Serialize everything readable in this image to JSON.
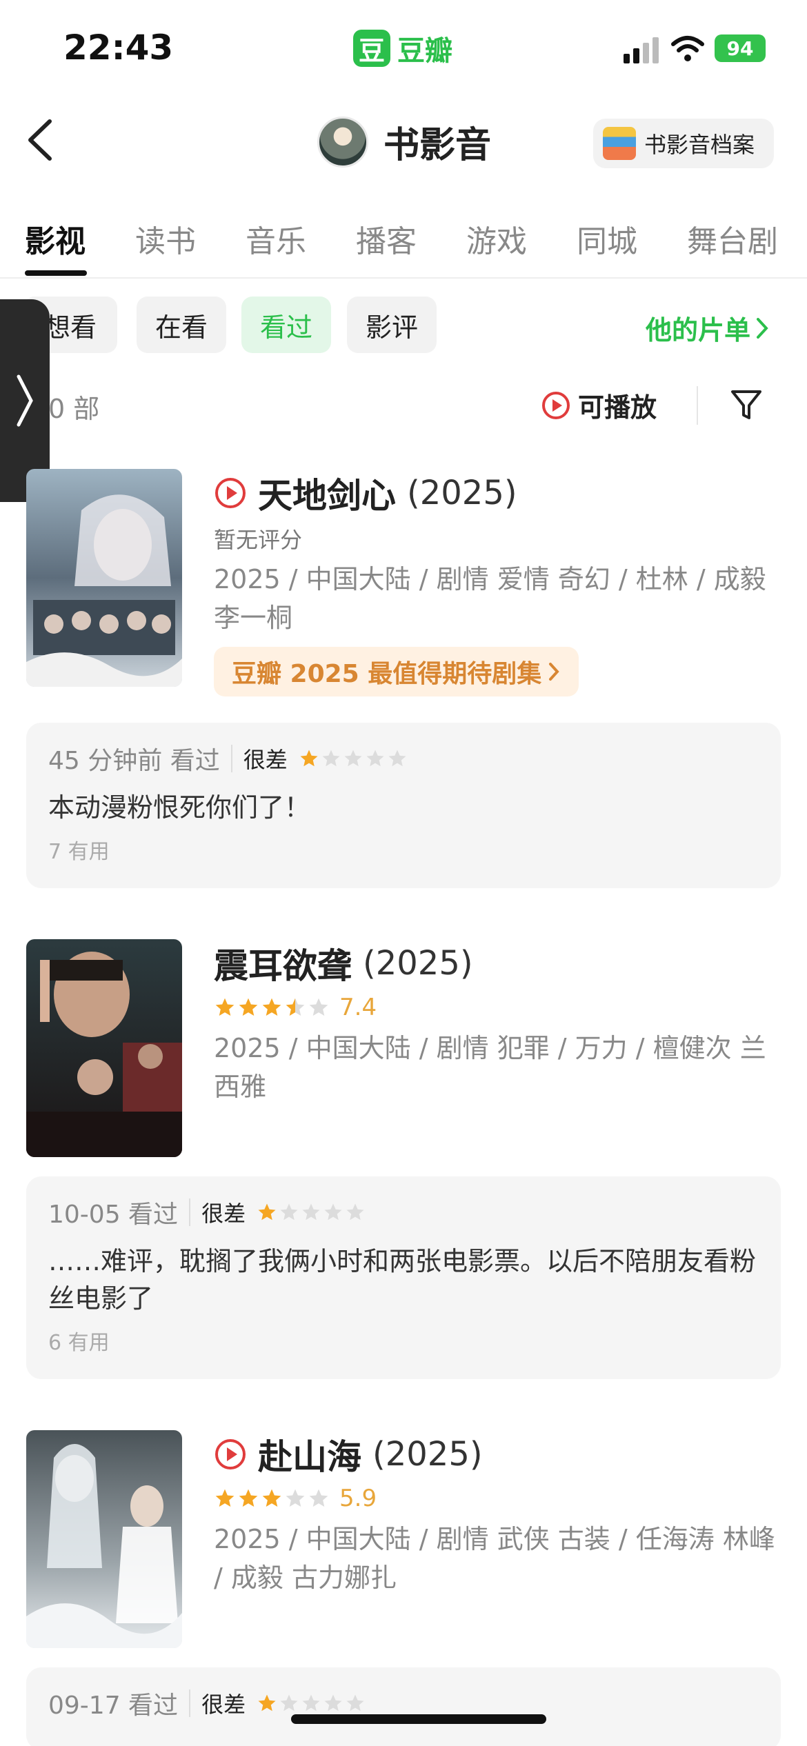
{
  "status_bar": {
    "time": "22:43",
    "app_logo": "豆",
    "app_name": "豆瓣",
    "battery": "94"
  },
  "header": {
    "title": "书影音",
    "archive_label": "书影音档案"
  },
  "tabs": [
    {
      "label": "影视"
    },
    {
      "label": "读书"
    },
    {
      "label": "音乐"
    },
    {
      "label": "播客"
    },
    {
      "label": "游戏"
    },
    {
      "label": "同城"
    },
    {
      "label": "舞台剧"
    }
  ],
  "filters": {
    "chips": [
      "想看",
      "在看",
      "看过",
      "影评"
    ],
    "active": "看过",
    "my_list": "他的片单"
  },
  "list": {
    "count": "0 部",
    "playable_label": "可播放"
  },
  "movies": [
    {
      "title": "天地剑心",
      "year": "(2025)",
      "rating_text": "暂无评分",
      "meta": "2025 / 中国大陆 / 剧情 爱情 奇幻 / 杜林 / 成毅 李一桐",
      "promo": "豆瓣 2025 最值得期待剧集",
      "review": {
        "time": "45 分钟前 看过",
        "label": "很差",
        "stars": 1,
        "text": "本动漫粉恨死你们了！",
        "useful": "7 有用"
      }
    },
    {
      "title": "震耳欲聋",
      "year": "(2025)",
      "score": "7.4",
      "stars": 3.5,
      "meta": "2025 / 中国大陆 / 剧情 犯罪 / 万力 / 檀健次 兰西雅",
      "review": {
        "time": "10-05 看过",
        "label": "很差",
        "stars": 1,
        "text": "……难评，耽搁了我俩小时和两张电影票。以后不陪朋友看粉丝电影了",
        "useful": "6 有用"
      }
    },
    {
      "title": "赴山海",
      "year": "(2025)",
      "score": "5.9",
      "stars": 3,
      "meta": "2025 / 中国大陆 / 剧情 武侠 古装 / 任海涛 林峰 / 成毅 古力娜扎",
      "review": {
        "time": "09-17 看过",
        "label": "很差",
        "stars": 1
      }
    }
  ],
  "colors": {
    "brand_green": "#2bbf4b",
    "star": "#f5a623",
    "play_red": "#e03c3c",
    "promo_text": "#d88632"
  }
}
